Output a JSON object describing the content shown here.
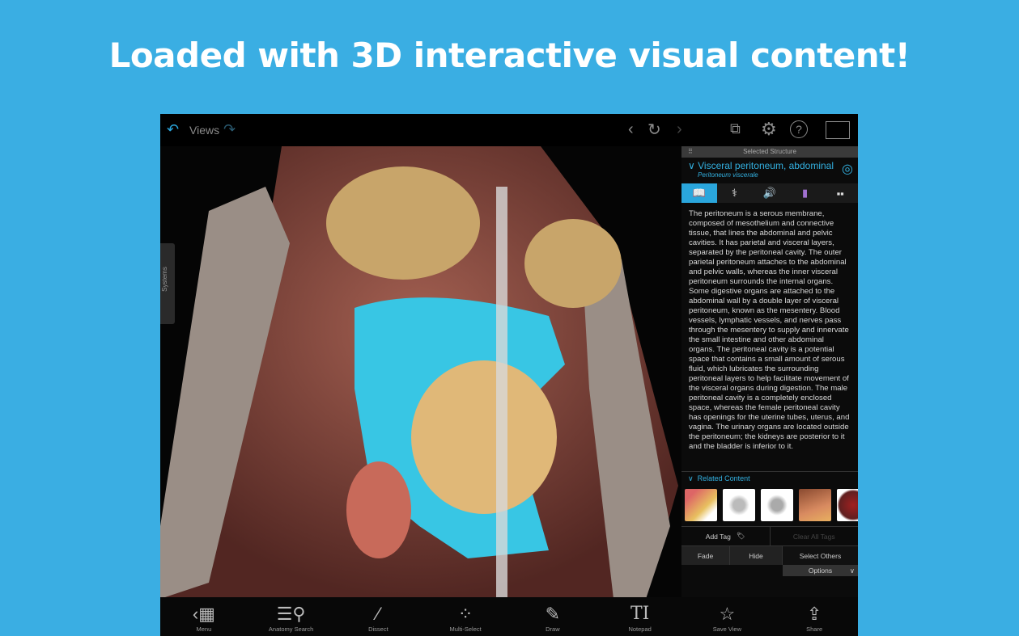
{
  "headline": "Loaded with 3D interactive visual content!",
  "topbar": {
    "views_label": "Views"
  },
  "systems_label": "Systems",
  "panel": {
    "header": "Selected Structure",
    "title": "Visceral peritoneum, abdominal",
    "subtitle": "Peritoneum viscerale",
    "description": "The peritoneum is a serous membrane, composed of mesothelium and connective tissue, that lines the abdominal and pelvic cavities. It has parietal and visceral layers, separated by the peritoneal cavity. The outer parietal peritoneum attaches to the abdominal and pelvic walls, whereas the inner visceral peritoneum surrounds the internal organs. Some digestive organs are attached to the abdominal wall by a double layer of visceral peritoneum, known as the mesentery. Blood vessels, lymphatic vessels, and nerves pass through the mesentery to supply and innervate the small intestine and other abdominal organs. The peritoneal cavity is a potential space that contains a small amount of serous fluid, which lubricates the surrounding peritoneal layers to help facilitate movement of the visceral organs during digestion. The male peritoneal cavity is a completely enclosed space, whereas the female peritoneal cavity has openings for the uterine tubes, uterus, and vagina. The urinary organs are located outside the peritoneum; the kidneys are posterior to it and the bladder is inferior to it.",
    "related_label": "Related Content",
    "add_tag": "Add Tag",
    "clear_tags": "Clear All Tags",
    "fade": "Fade",
    "hide": "Hide",
    "select_others": "Select Others",
    "options": "Options"
  },
  "toolbar": [
    {
      "label": "Menu",
      "icon": "menu-icon"
    },
    {
      "label": "Anatomy Search",
      "icon": "search-icon"
    },
    {
      "label": "Dissect",
      "icon": "scalpel-icon"
    },
    {
      "label": "Multi-Select",
      "icon": "multi-select-icon"
    },
    {
      "label": "Draw",
      "icon": "pencil-icon"
    },
    {
      "label": "Notepad",
      "icon": "text-icon"
    },
    {
      "label": "Save View",
      "icon": "star-icon"
    },
    {
      "label": "Share",
      "icon": "share-icon"
    }
  ],
  "colors": {
    "accent": "#2aa6dc",
    "background": "#3aaee3"
  }
}
